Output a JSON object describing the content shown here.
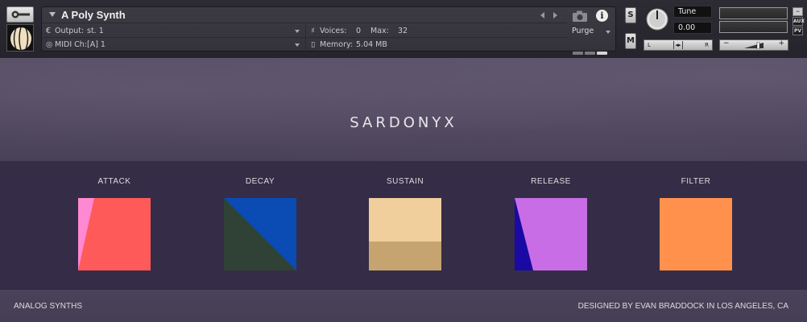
{
  "header": {
    "instrument_name": "A Poly Synth",
    "output_label": "Output:",
    "output_value": "st. 1",
    "voices_label": "Voices:",
    "voices_value": "0",
    "max_label": "Max:",
    "max_value": "32",
    "midi_label": "MIDI Ch:",
    "midi_value": "[A]  1",
    "memory_label": "Memory:",
    "memory_value": "5.04 MB",
    "purge_label": "Purge",
    "solo_label": "S",
    "mute_label": "M",
    "tune_label": "Tune",
    "tune_value": "0.00",
    "pan_left": "L",
    "pan_right": "R",
    "vol_minus": "−",
    "vol_plus": "+",
    "side_buttons": [
      "−",
      "AUX",
      "PV"
    ]
  },
  "body": {
    "logo": "SARDONYX",
    "controls": [
      {
        "label": "ATTACK",
        "color_main": "#ff5a5a",
        "color_accent": "#ff88d2"
      },
      {
        "label": "DECAY",
        "color_main": "#0a4bb4",
        "color_accent": "#2f4235"
      },
      {
        "label": "SUSTAIN",
        "color_main": "#f0cf9c",
        "color_accent": "#c6a470"
      },
      {
        "label": "RELEASE",
        "color_main": "#c86de6",
        "color_accent": "#1a0aa3"
      },
      {
        "label": "FILTER",
        "color_main": "#ff914d"
      }
    ],
    "footer_left": "ANALOG SYNTHS",
    "footer_right": "DESIGNED BY EVAN BRADDOCK IN LOS ANGELES, CA"
  },
  "colors": {
    "panel_bg": "#352d47",
    "body_bg": "#4a4258",
    "header_bg": "#2d2b33"
  }
}
